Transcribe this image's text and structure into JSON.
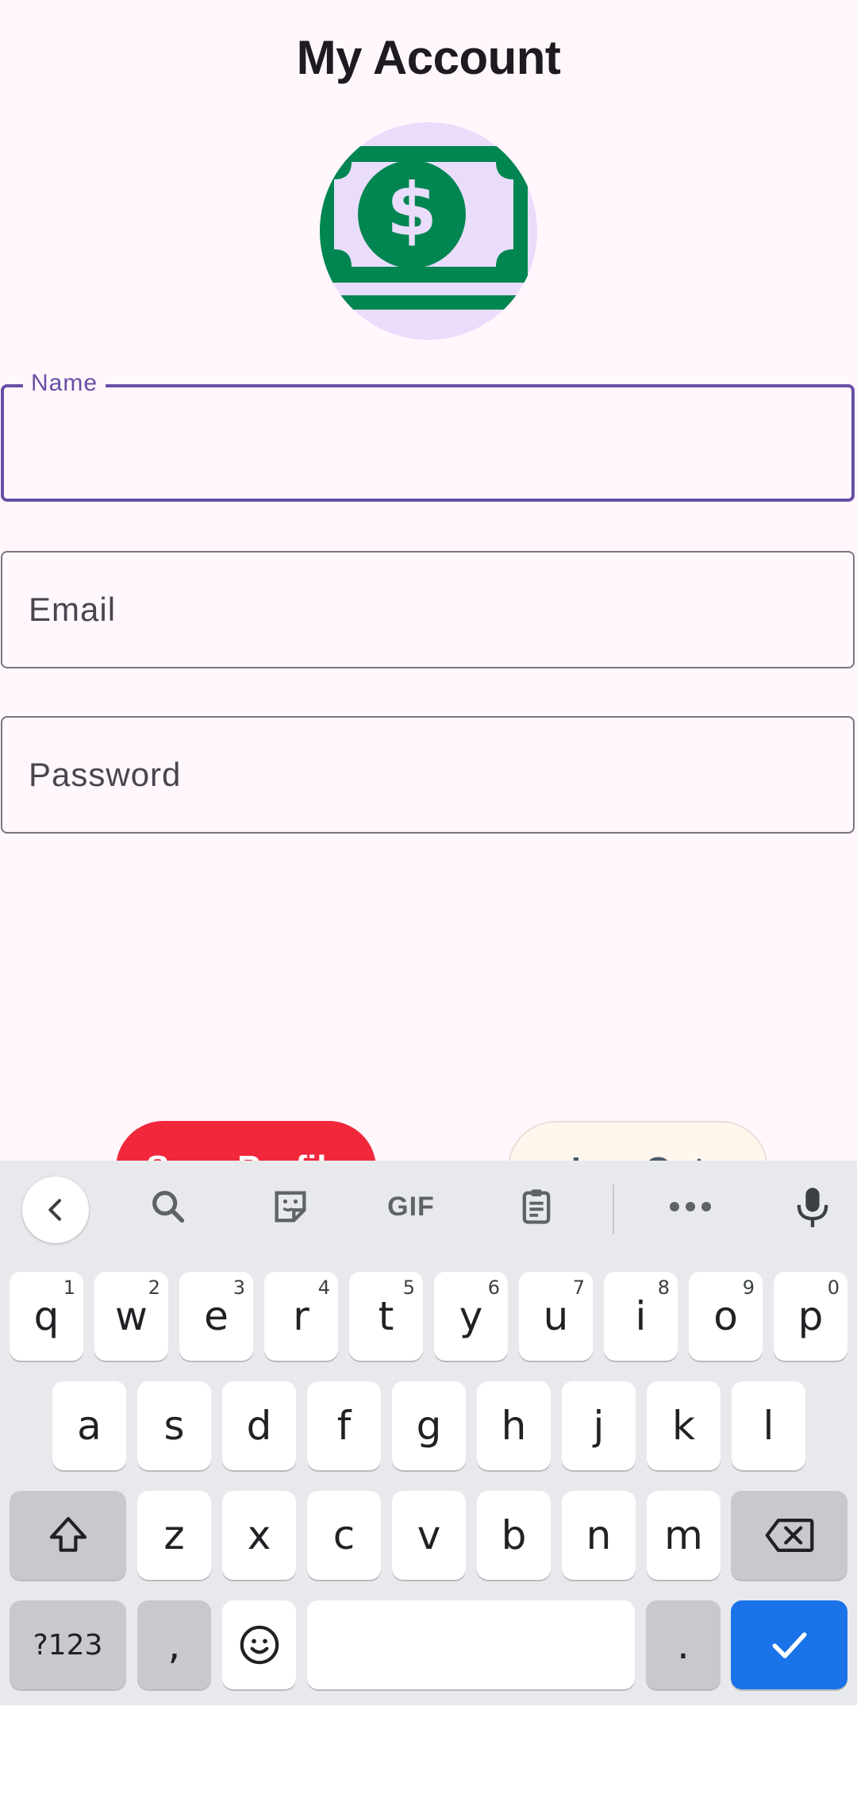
{
  "header": {
    "title": "My Account"
  },
  "avatar": {
    "icon": "money-bill-icon",
    "colors": {
      "bg": "#e9ddfb",
      "bill": "#018551",
      "inner": "#e9ddfb"
    }
  },
  "form": {
    "name": {
      "label": "Name",
      "value": ""
    },
    "email": {
      "placeholder": "Email"
    },
    "password": {
      "placeholder": "Password"
    }
  },
  "buttons": {
    "save": {
      "label": "Save Profile",
      "color": "#f1283c"
    },
    "logout": {
      "label": "Log Out"
    }
  },
  "keyboard": {
    "toolbar": [
      "back-icon",
      "search-icon",
      "sticker-icon",
      "GIF",
      "clipboard-icon",
      "more-icon",
      "mic-icon"
    ],
    "gif_label": "GIF",
    "row1": [
      {
        "k": "q",
        "h": "1"
      },
      {
        "k": "w",
        "h": "2"
      },
      {
        "k": "e",
        "h": "3"
      },
      {
        "k": "r",
        "h": "4"
      },
      {
        "k": "t",
        "h": "5"
      },
      {
        "k": "y",
        "h": "6"
      },
      {
        "k": "u",
        "h": "7"
      },
      {
        "k": "i",
        "h": "8"
      },
      {
        "k": "o",
        "h": "9"
      },
      {
        "k": "p",
        "h": "0"
      }
    ],
    "row2": [
      "a",
      "s",
      "d",
      "f",
      "g",
      "h",
      "j",
      "k",
      "l"
    ],
    "row3": [
      "z",
      "x",
      "c",
      "v",
      "b",
      "n",
      "m"
    ],
    "sym_label": "?123",
    "comma": ",",
    "period": ".",
    "accent": "#1a73e8"
  }
}
